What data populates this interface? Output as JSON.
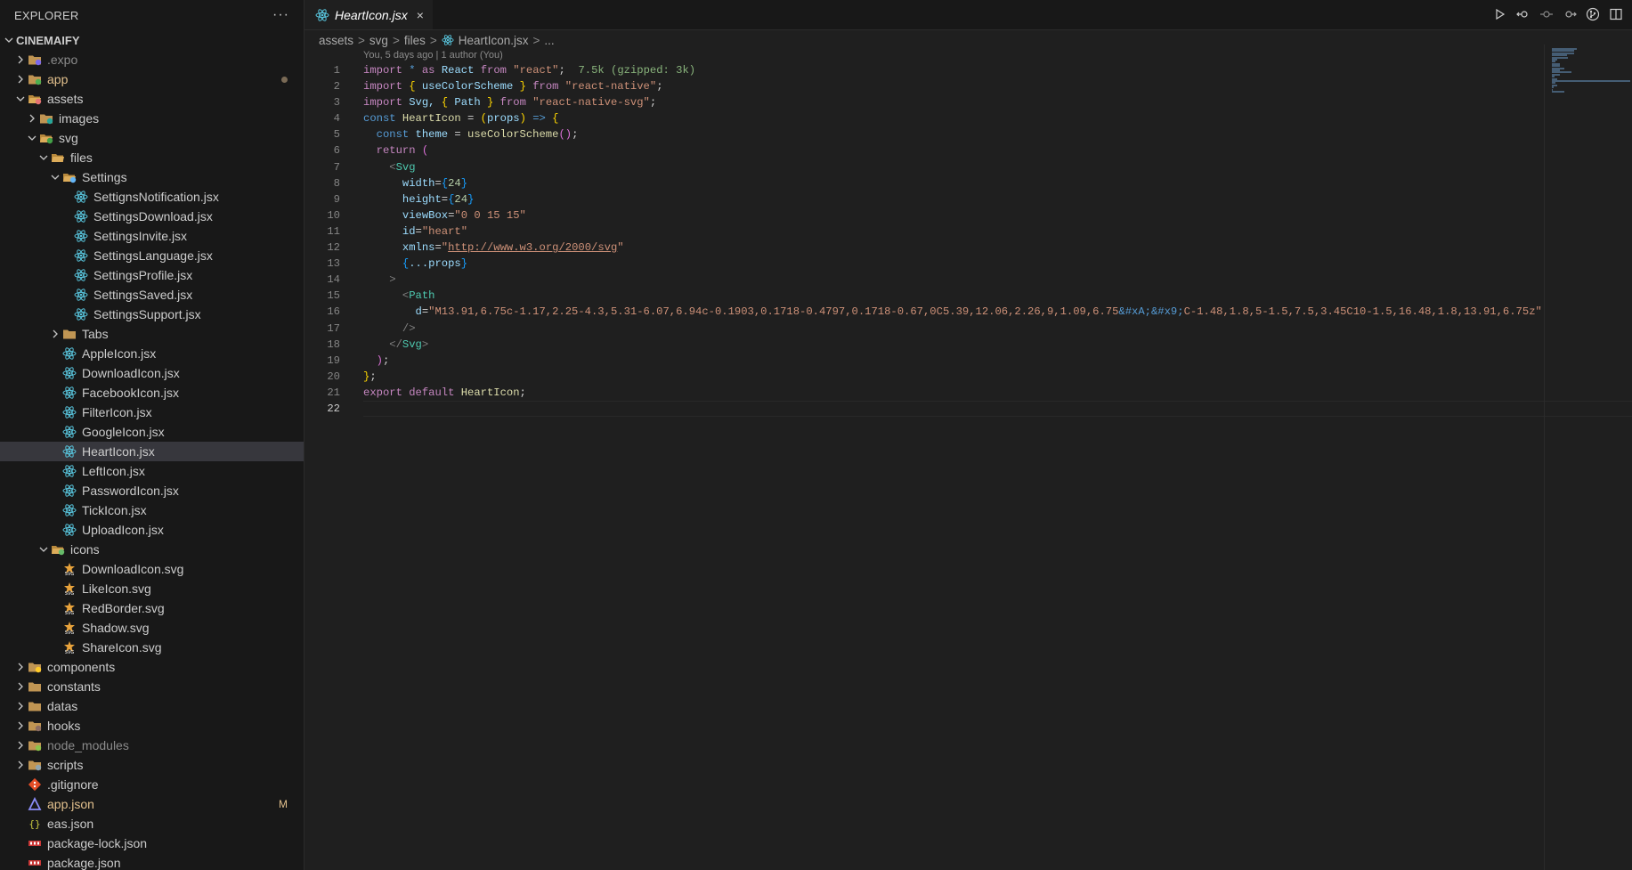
{
  "explorer": {
    "title": "EXPLORER",
    "more_label": "···",
    "project": "CINEMAIFY",
    "items": [
      {
        "label": ".expo",
        "level": 1,
        "type": "folder",
        "state": "closed",
        "dim": true,
        "icon": "expo-folder-icon"
      },
      {
        "label": "app",
        "level": 1,
        "type": "folder",
        "state": "closed",
        "yellow": true,
        "dot": true,
        "icon": "app-folder-icon"
      },
      {
        "label": "assets",
        "level": 1,
        "type": "folder",
        "state": "open",
        "icon": "assets-folder-icon"
      },
      {
        "label": "images",
        "level": 2,
        "type": "folder",
        "state": "closed",
        "icon": "images-folder-icon"
      },
      {
        "label": "svg",
        "level": 2,
        "type": "folder",
        "state": "open",
        "icon": "svg-folder-icon"
      },
      {
        "label": "files",
        "level": 3,
        "type": "folder",
        "state": "open",
        "icon": "folder-icon"
      },
      {
        "label": "Settings",
        "level": 4,
        "type": "folder",
        "state": "open",
        "icon": "settings-folder-icon"
      },
      {
        "label": "SettignsNotification.jsx",
        "level": 5,
        "type": "react"
      },
      {
        "label": "SettingsDownload.jsx",
        "level": 5,
        "type": "react"
      },
      {
        "label": "SettingsInvite.jsx",
        "level": 5,
        "type": "react"
      },
      {
        "label": "SettingsLanguage.jsx",
        "level": 5,
        "type": "react"
      },
      {
        "label": "SettingsProfile.jsx",
        "level": 5,
        "type": "react"
      },
      {
        "label": "SettingsSaved.jsx",
        "level": 5,
        "type": "react"
      },
      {
        "label": "SettingsSupport.jsx",
        "level": 5,
        "type": "react"
      },
      {
        "label": "Tabs",
        "level": 4,
        "type": "folder",
        "state": "closed",
        "icon": "folder-icon"
      },
      {
        "label": "AppleIcon.jsx",
        "level": 4,
        "type": "react"
      },
      {
        "label": "DownloadIcon.jsx",
        "level": 4,
        "type": "react"
      },
      {
        "label": "FacebookIcon.jsx",
        "level": 4,
        "type": "react"
      },
      {
        "label": "FilterIcon.jsx",
        "level": 4,
        "type": "react"
      },
      {
        "label": "GoogleIcon.jsx",
        "level": 4,
        "type": "react"
      },
      {
        "label": "HeartIcon.jsx",
        "level": 4,
        "type": "react",
        "selected": true
      },
      {
        "label": "LeftIcon.jsx",
        "level": 4,
        "type": "react"
      },
      {
        "label": "PasswordIcon.jsx",
        "level": 4,
        "type": "react"
      },
      {
        "label": "TickIcon.jsx",
        "level": 4,
        "type": "react"
      },
      {
        "label": "UploadIcon.jsx",
        "level": 4,
        "type": "react"
      },
      {
        "label": "icons",
        "level": 3,
        "type": "folder",
        "state": "open",
        "icon": "icons-folder-icon"
      },
      {
        "label": "DownloadIcon.svg",
        "level": 4,
        "type": "svg"
      },
      {
        "label": "LikeIcon.svg",
        "level": 4,
        "type": "svg"
      },
      {
        "label": "RedBorder.svg",
        "level": 4,
        "type": "svg"
      },
      {
        "label": "Shadow.svg",
        "level": 4,
        "type": "svg"
      },
      {
        "label": "ShareIcon.svg",
        "level": 4,
        "type": "svg"
      },
      {
        "label": "components",
        "level": 1,
        "type": "folder",
        "state": "closed",
        "icon": "components-folder-icon"
      },
      {
        "label": "constants",
        "level": 1,
        "type": "folder",
        "state": "closed",
        "icon": "folder-icon"
      },
      {
        "label": "datas",
        "level": 1,
        "type": "folder",
        "state": "closed",
        "icon": "folder-icon"
      },
      {
        "label": "hooks",
        "level": 1,
        "type": "folder",
        "state": "closed",
        "icon": "hooks-folder-icon"
      },
      {
        "label": "node_modules",
        "level": 1,
        "type": "folder",
        "state": "closed",
        "dim": true,
        "icon": "node-folder-icon"
      },
      {
        "label": "scripts",
        "level": 1,
        "type": "folder",
        "state": "closed",
        "icon": "scripts-folder-icon"
      },
      {
        "label": ".gitignore",
        "level": 1,
        "type": "git"
      },
      {
        "label": "app.json",
        "level": 1,
        "type": "expo",
        "yellow": true,
        "badge": "M"
      },
      {
        "label": "eas.json",
        "level": 1,
        "type": "json"
      },
      {
        "label": "package-lock.json",
        "level": 1,
        "type": "npm"
      },
      {
        "label": "package.json",
        "level": 1,
        "type": "npm"
      }
    ]
  },
  "tab": {
    "label": "HeartIcon.jsx",
    "close": "×"
  },
  "breadcrumb": [
    "assets",
    "svg",
    "files",
    "HeartIcon.jsx",
    "..."
  ],
  "breadcrumb_sep": ">",
  "blame": "You, 5 days ago | 1 author (You)",
  "colors": {
    "accent": "#0078d4",
    "react": "#58c4dc",
    "folder": "#c09553"
  },
  "code_lines": [
    [
      [
        "import",
        "kw"
      ],
      [
        " ",
        "punct"
      ],
      [
        "*",
        "kw2"
      ],
      [
        " as ",
        "kw"
      ],
      [
        "React",
        "var"
      ],
      [
        " from ",
        "kw"
      ],
      [
        "\"react\"",
        "str"
      ],
      [
        ";",
        "punct"
      ],
      [
        "  7.5k (gzipped: 3k)",
        "hint"
      ]
    ],
    [
      [
        "import",
        "kw"
      ],
      [
        " ",
        "punct"
      ],
      [
        "{",
        "br"
      ],
      [
        " useColorScheme ",
        "var"
      ],
      [
        "}",
        "br"
      ],
      [
        " from ",
        "kw"
      ],
      [
        "\"react-native\"",
        "str"
      ],
      [
        ";",
        "punct"
      ]
    ],
    [
      [
        "import",
        "kw"
      ],
      [
        " Svg, ",
        "var"
      ],
      [
        "{",
        "br"
      ],
      [
        " Path ",
        "var"
      ],
      [
        "}",
        "br"
      ],
      [
        " from ",
        "kw"
      ],
      [
        "\"react-native-svg\"",
        "str"
      ],
      [
        ";",
        "punct"
      ]
    ],
    [
      [
        "const",
        "kw2"
      ],
      [
        " HeartIcon ",
        "fn"
      ],
      [
        "= ",
        "punct"
      ],
      [
        "(",
        "br"
      ],
      [
        "props",
        "var"
      ],
      [
        ")",
        "br"
      ],
      [
        " => ",
        "kw2"
      ],
      [
        "{",
        "br"
      ]
    ],
    [
      [
        "  const",
        "kw2"
      ],
      [
        " theme ",
        "var"
      ],
      [
        "= ",
        "punct"
      ],
      [
        "useColorScheme",
        "fn"
      ],
      [
        "()",
        "br2"
      ],
      [
        ";",
        "punct"
      ]
    ],
    [
      [
        "  return",
        "kw"
      ],
      [
        " ",
        "punct"
      ],
      [
        "(",
        "br2"
      ]
    ],
    [
      [
        "    <",
        "tagp"
      ],
      [
        "Svg",
        "tag"
      ]
    ],
    [
      [
        "      width",
        "attr"
      ],
      [
        "=",
        "punct"
      ],
      [
        "{",
        "br3"
      ],
      [
        "24",
        "num"
      ],
      [
        "}",
        "br3"
      ]
    ],
    [
      [
        "      height",
        "attr"
      ],
      [
        "=",
        "punct"
      ],
      [
        "{",
        "br3"
      ],
      [
        "24",
        "num"
      ],
      [
        "}",
        "br3"
      ]
    ],
    [
      [
        "      viewBox",
        "attr"
      ],
      [
        "=",
        "punct"
      ],
      [
        "\"0 0 15 15\"",
        "str"
      ]
    ],
    [
      [
        "      id",
        "attr"
      ],
      [
        "=",
        "punct"
      ],
      [
        "\"heart\"",
        "str"
      ]
    ],
    [
      [
        "      xmlns",
        "attr"
      ],
      [
        "=",
        "punct"
      ],
      [
        "\"",
        "str"
      ],
      [
        "http://www.w3.org/2000/svg",
        "url"
      ],
      [
        "\"",
        "str"
      ]
    ],
    [
      [
        "      ",
        "punct"
      ],
      [
        "{",
        "br3"
      ],
      [
        "...props",
        "var"
      ],
      [
        "}",
        "br3"
      ]
    ],
    [
      [
        "    >",
        "tagp"
      ]
    ],
    [
      [
        "      <",
        "tagp"
      ],
      [
        "Path",
        "tag"
      ]
    ],
    [
      [
        "        d",
        "attr"
      ],
      [
        "=",
        "punct"
      ],
      [
        "\"M13.91,6.75c-1.17,2.25-4.3,5.31-6.07,6.94c-0.1903,0.1718-0.4797,0.1718-0.67,0C5.39,12.06,2.26,9,1.09,6.75",
        "str"
      ],
      [
        "&#xA;&#x9;",
        "ent"
      ],
      [
        "C-1.48,1.8,5-1.5,7.5,3.45C10-1.5,16.48,1.8,13.91,6.75z\"",
        "str"
      ]
    ],
    [
      [
        "      />",
        "tagp"
      ]
    ],
    [
      [
        "    </",
        "tagp"
      ],
      [
        "Svg",
        "tag"
      ],
      [
        ">",
        "tagp"
      ]
    ],
    [
      [
        "  )",
        "br2"
      ],
      [
        ";",
        "punct"
      ]
    ],
    [
      [
        "}",
        "br"
      ],
      [
        ";",
        "punct"
      ]
    ],
    [
      [
        "export",
        "kw"
      ],
      [
        " default ",
        "kw"
      ],
      [
        "HeartIcon",
        "fn"
      ],
      [
        ";",
        "punct"
      ]
    ],
    []
  ]
}
